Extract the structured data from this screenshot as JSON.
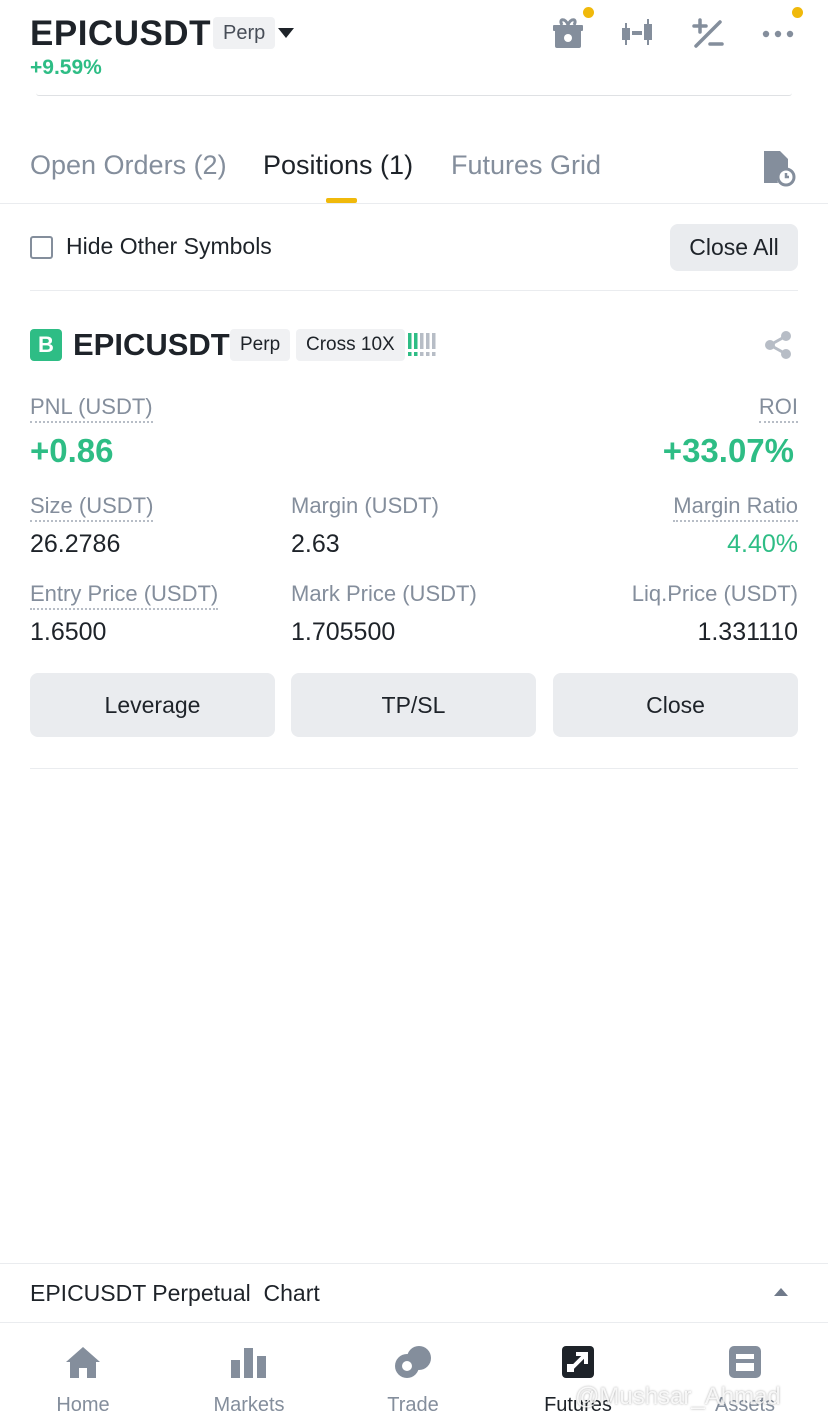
{
  "header": {
    "symbol": "EPICUSDT",
    "contract_type": "Perp",
    "change": "+9.59%",
    "icons": [
      "gift-icon",
      "candlestick-icon",
      "plus-minus-icon",
      "more-icon"
    ]
  },
  "tabs": [
    {
      "label": "Open Orders (2)",
      "active": false
    },
    {
      "label": "Positions (1)",
      "active": true
    },
    {
      "label": "Futures Grid",
      "active": false
    }
  ],
  "filter": {
    "hide_other_symbols_label": "Hide Other Symbols",
    "hide_other_symbols_checked": false,
    "close_all_label": "Close All"
  },
  "position": {
    "side": "B",
    "symbol": "EPICUSDT",
    "contract_type": "Perp",
    "margin_mode": "Cross 10X",
    "pnl_label": "PNL (USDT)",
    "pnl_value": "+0.86",
    "roi_label": "ROI",
    "roi_value": "+33.07%",
    "size_label": "Size (USDT)",
    "size_value": "26.2786",
    "margin_label": "Margin (USDT)",
    "margin_value": "2.63",
    "margin_ratio_label": "Margin Ratio",
    "margin_ratio_value": "4.40%",
    "entry_price_label": "Entry Price (USDT)",
    "entry_price_value": "1.6500",
    "mark_price_label": "Mark Price (USDT)",
    "mark_price_value": "1.705500",
    "liq_price_label": "Liq.Price (USDT)",
    "liq_price_value": "1.331110"
  },
  "actions": {
    "leverage": "Leverage",
    "tpsl": "TP/SL",
    "close": "Close"
  },
  "chart_bar": {
    "label": "EPICUSDT Perpetual  Chart"
  },
  "bottom_nav": [
    {
      "label": "Home",
      "icon": "home-icon",
      "active": false
    },
    {
      "label": "Markets",
      "icon": "markets-icon",
      "active": false
    },
    {
      "label": "Trade",
      "icon": "trade-icon",
      "active": false
    },
    {
      "label": "Futures",
      "icon": "futures-icon",
      "active": true
    },
    {
      "label": "Assets",
      "icon": "assets-icon",
      "active": false
    }
  ],
  "watermark": "@Mushsar_Ahmad",
  "colors": {
    "green": "#2ebd85",
    "accent": "#f0b90b",
    "text": "#1e2329",
    "muted": "#848e9c"
  }
}
